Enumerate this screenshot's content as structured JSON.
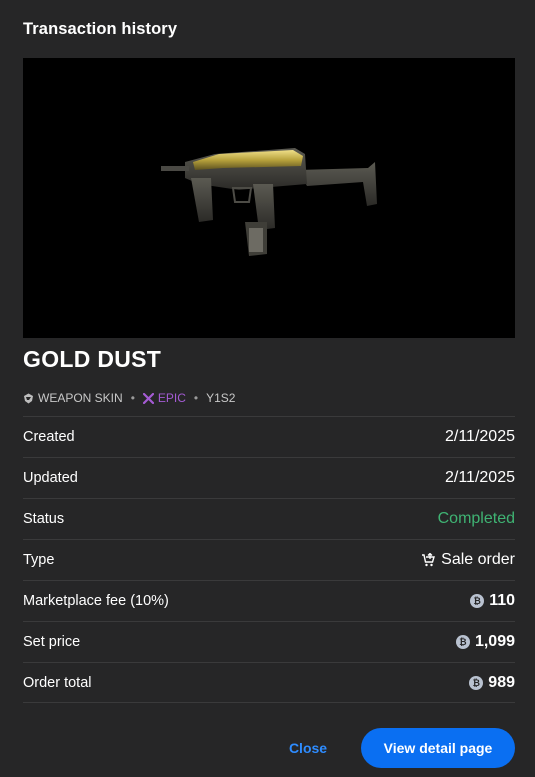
{
  "dialog": {
    "title": "Transaction history"
  },
  "item": {
    "name": "GOLD DUST",
    "category_icon": "weapon-skin-icon",
    "category": "WEAPON SKIN",
    "rarity_icon": "epic-rarity-icon",
    "rarity": "EPIC",
    "season": "Y1S2",
    "colors": {
      "epic": "#a45bd3"
    }
  },
  "details": {
    "rows": [
      {
        "label": "Created",
        "value": "2/11/2025"
      },
      {
        "label": "Updated",
        "value": "2/11/2025"
      },
      {
        "label": "Status",
        "value": "Completed"
      },
      {
        "label": "Type",
        "value": "Sale order",
        "icon": "sale-order-icon"
      },
      {
        "label": "Marketplace fee (10%)",
        "value": "110",
        "icon": "credit-coin-icon"
      },
      {
        "label": "Set price",
        "value": "1,099",
        "icon": "credit-coin-icon"
      },
      {
        "label": "Order total",
        "value": "989",
        "icon": "credit-coin-icon"
      }
    ],
    "colors": {
      "status": "#3fb373"
    }
  },
  "actions": {
    "close_label": "Close",
    "detail_label": "View detail page",
    "colors": {
      "primary": "#0a6ff2",
      "link": "#2e8cff"
    }
  }
}
